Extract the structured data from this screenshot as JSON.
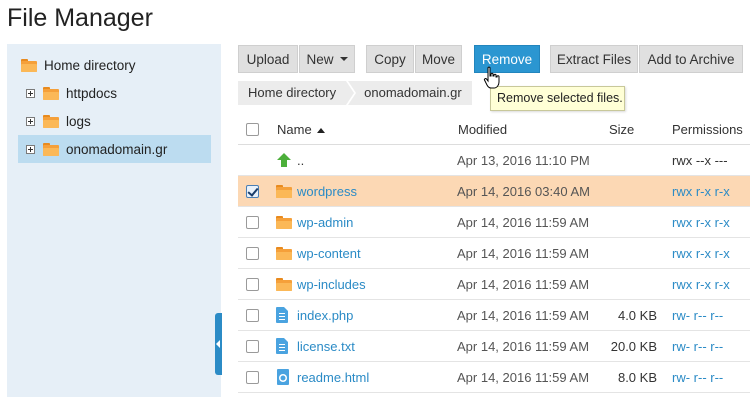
{
  "title": "File Manager",
  "sidebar": {
    "root": "Home directory",
    "items": [
      {
        "label": "httpdocs"
      },
      {
        "label": "logs"
      },
      {
        "label": "onomadomain.gr",
        "selected": true
      }
    ]
  },
  "toolbar": {
    "upload": "Upload",
    "new": "New",
    "copy": "Copy",
    "move": "Move",
    "remove": "Remove",
    "extract": "Extract Files",
    "archive": "Add to Archive"
  },
  "breadcrumb": [
    "Home directory",
    "onomadomain.gr"
  ],
  "tooltip": "Remove selected files.",
  "columns": {
    "name": "Name",
    "modified": "Modified",
    "size": "Size",
    "permissions": "Permissions"
  },
  "rows": [
    {
      "name": "..",
      "icon": "up-arrow-icon",
      "modified": "Apr 13, 2016 11:10 PM",
      "size": "",
      "permissions": "rwx --x ---",
      "checkbox": false
    },
    {
      "name": "wordpress",
      "icon": "folder-icon",
      "modified": "Apr 14, 2016 03:40 AM",
      "size": "",
      "permissions": "rwx r-x r-x",
      "checkbox": true,
      "checked": true,
      "selected": true
    },
    {
      "name": "wp-admin",
      "icon": "folder-icon",
      "modified": "Apr 14, 2016 11:59 AM",
      "size": "",
      "permissions": "rwx r-x r-x",
      "checkbox": true
    },
    {
      "name": "wp-content",
      "icon": "folder-icon",
      "modified": "Apr 14, 2016 11:59 AM",
      "size": "",
      "permissions": "rwx r-x r-x",
      "checkbox": true
    },
    {
      "name": "wp-includes",
      "icon": "folder-icon",
      "modified": "Apr 14, 2016 11:59 AM",
      "size": "",
      "permissions": "rwx r-x r-x",
      "checkbox": true
    },
    {
      "name": "index.php",
      "icon": "php-file-icon",
      "modified": "Apr 14, 2016 11:59 AM",
      "size": "4.0 KB",
      "permissions": "rw- r-- r--",
      "checkbox": true
    },
    {
      "name": "license.txt",
      "icon": "text-file-icon",
      "modified": "Apr 14, 2016 11:59 AM",
      "size": "20.0 KB",
      "permissions": "rw- r-- r--",
      "checkbox": true
    },
    {
      "name": "readme.html",
      "icon": "html-file-icon",
      "modified": "Apr 14, 2016 11:59 AM",
      "size": "8.0 KB",
      "permissions": "rw- r-- r--",
      "checkbox": true
    }
  ],
  "colors": {
    "accent": "#2b96d1",
    "selected_row": "#fcd8b4",
    "sidebar_bg": "#e6eff7",
    "folder": "#f5a03a"
  }
}
